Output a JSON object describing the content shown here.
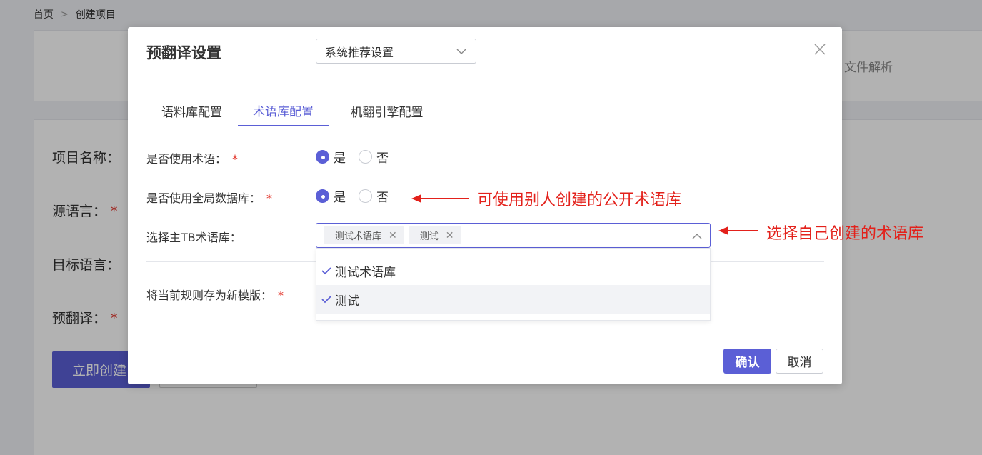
{
  "breadcrumb": {
    "home": "首页",
    "current": "创建项目"
  },
  "background": {
    "step_label": "文件解析",
    "labels": {
      "project_name": "项目名称：",
      "source_lang": "源语言：",
      "target_lang": "目标语言：",
      "pretranslate": "预翻译："
    },
    "required_mark": "*",
    "create_button": "立即创建"
  },
  "dialog": {
    "title": "预翻译设置",
    "preset": {
      "value": "系统推荐设置"
    },
    "tabs": [
      {
        "label": "语料库配置"
      },
      {
        "label": "术语库配置"
      },
      {
        "label": "机翻引擎配置"
      }
    ],
    "active_tab": 1,
    "rows": {
      "use_term": {
        "label": "是否使用术语：",
        "options": [
          "是",
          "否"
        ],
        "selected": "是"
      },
      "use_global": {
        "label": "是否使用全局数据库：",
        "options": [
          "是",
          "否"
        ],
        "selected": "是"
      },
      "main_tb": {
        "label": "选择主TB术语库：",
        "tags": [
          "测试术语库",
          "测试"
        ]
      },
      "save_template": {
        "label": "将当前规则存为新模版："
      }
    },
    "required_mark": "*",
    "dropdown_options": [
      {
        "label": "测试术语库",
        "checked": true
      },
      {
        "label": "测试",
        "checked": true
      }
    ],
    "confirm": "确认",
    "cancel": "取消"
  },
  "annotations": {
    "global": "可使用别人创建的公开术语库",
    "own": "选择自己创建的术语库"
  },
  "colors": {
    "accent": "#5b5fd6",
    "required": "#e3352b",
    "annotation": "#e3211b"
  },
  "icons": {
    "close": "close-icon",
    "chevron_down": "chevron-down-icon",
    "chevron_up": "chevron-up-icon",
    "check": "check-icon",
    "arrow": "arrow-left-icon"
  }
}
